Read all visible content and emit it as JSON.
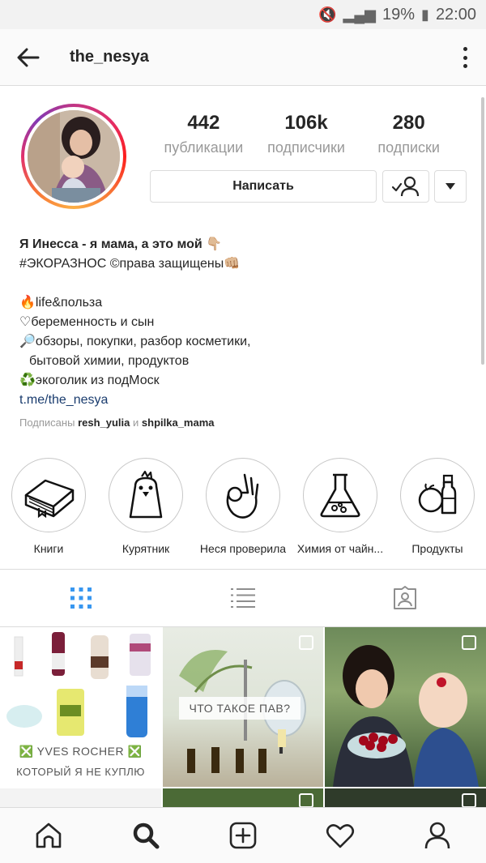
{
  "status_bar": {
    "battery": "19%",
    "time": "22:00"
  },
  "header": {
    "username": "the_nesya"
  },
  "profile": {
    "stats": [
      {
        "value": "442",
        "label": "публикации"
      },
      {
        "value": "106k",
        "label": "подписчики"
      },
      {
        "value": "280",
        "label": "подписки"
      }
    ],
    "message_button": "Написать"
  },
  "bio": {
    "name": "Я Инесса - я мама, а это мой 👇🏼",
    "line1": "#ЭКОРАЗНОС ©права защищены👊🏼",
    "line2": "🔥life&польза",
    "line3": "♡беременность и сын",
    "line4": "🔎обзоры, покупки, разбор косметики,",
    "line5": "бытовой химии, продуктов",
    "line6": "♻️экоголик из подМоск",
    "link": "t.me/the_nesya",
    "followed_prefix": "Подписаны",
    "followed_user1": "resh_yulia",
    "followed_and": "и",
    "followed_user2": "shpilka_mama"
  },
  "highlights": [
    {
      "label": "Книги",
      "icon": "books-icon"
    },
    {
      "label": "Курятник",
      "icon": "chicken-icon"
    },
    {
      "label": "Неся проверила",
      "icon": "ok-hand-icon"
    },
    {
      "label": "Химия от чайн...",
      "icon": "flask-icon"
    },
    {
      "label": "Продукты",
      "icon": "groceries-icon"
    }
  ],
  "posts": {
    "tile1_brand": "YVES ROCHER",
    "tile1_caption": "КОТОРЫЙ Я НЕ КУПЛЮ",
    "tile2_caption": "ЧТО ТАКОЕ ПАВ?"
  },
  "colors": {
    "accent_blue": "#3897f0",
    "brand_red": "#d9363e"
  }
}
